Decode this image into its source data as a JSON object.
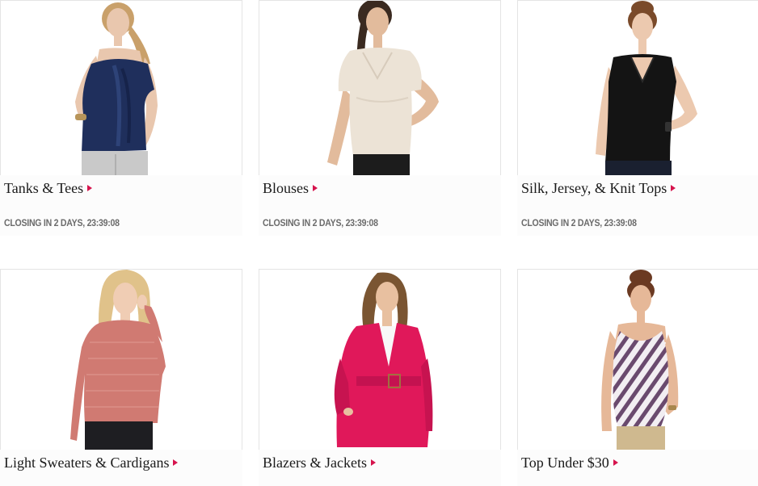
{
  "categories": [
    {
      "title": "Tanks & Tees",
      "closing": "CLOSING IN 2 DAYS, 23:39:08",
      "image": "navy-ruffle-tank",
      "colors": {
        "garment": "#1f2f5c",
        "skin": "#e9c7ae",
        "hair": "#c9a06a",
        "pants": "#c9c9c9"
      }
    },
    {
      "title": "Blouses",
      "closing": "CLOSING IN 2 DAYS, 23:39:08",
      "image": "ivory-draped-blouse",
      "colors": {
        "garment": "#ece3d6",
        "skin": "#e2bb9c",
        "hair": "#3a2a20",
        "pants": "#1c1c1c"
      }
    },
    {
      "title": "Silk, Jersey, & Knit Tops",
      "closing": "CLOSING IN 2 DAYS, 23:39:08",
      "image": "black-silk-top",
      "colors": {
        "garment": "#141414",
        "skin": "#ecc9af",
        "hair": "#7a4a2a",
        "pants": "#1a2030"
      }
    },
    {
      "title": "Light Sweaters & Cardigans",
      "image": "coral-knit-sweater",
      "colors": {
        "garment": "#d07a72",
        "skin": "#f0cdb4",
        "hair": "#e0c28a",
        "pants": "#1e1e22"
      }
    },
    {
      "title": "Blazers & Jackets",
      "image": "pink-belted-jacket",
      "colors": {
        "garment": "#e0185a",
        "skin": "#e8c0a0",
        "hair": "#7a5532",
        "pants": "#b0124a"
      }
    },
    {
      "title": "Top Under $30",
      "image": "striped-tank",
      "colors": {
        "garment": "#f2eef2",
        "stripe": "#6a4a6e",
        "skin": "#e6b898",
        "hair": "#6b3a22",
        "pants": "#cfb98f"
      }
    }
  ],
  "accent_color": "#d6144d"
}
